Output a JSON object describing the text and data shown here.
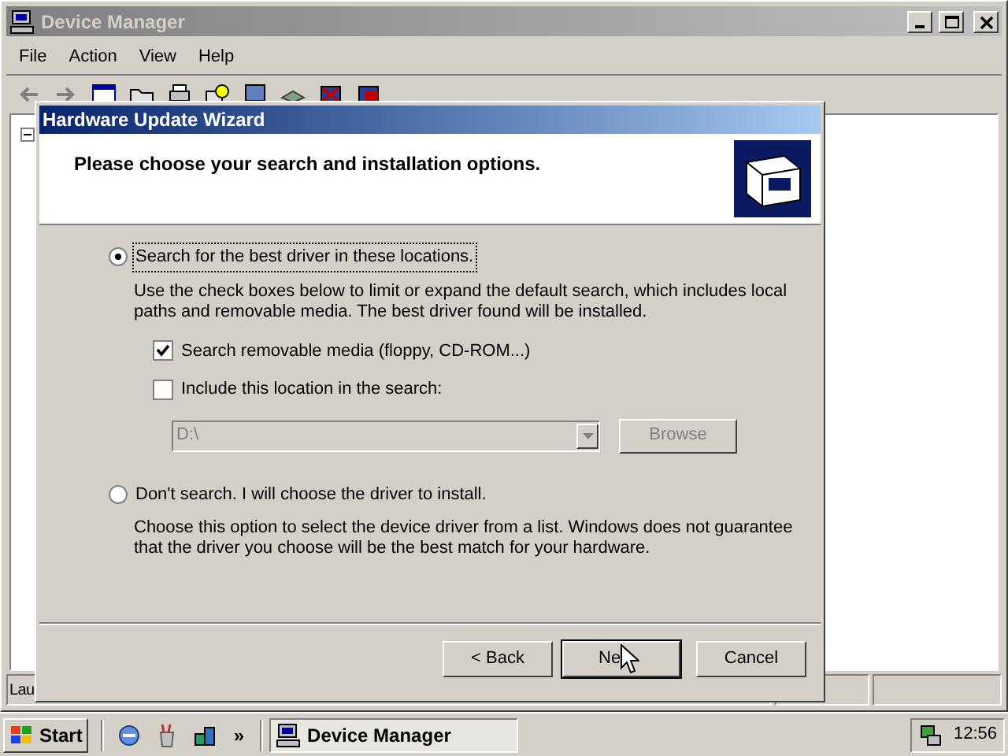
{
  "window": {
    "title": "Device Manager",
    "menu": [
      "File",
      "Action",
      "View",
      "Help"
    ],
    "status_bar": "Lau"
  },
  "wizard": {
    "title": "Hardware Update Wizard",
    "heading": "Please choose your search and installation options.",
    "options": [
      {
        "label": "Search for the best driver in these locations.",
        "selected": true,
        "description": "Use the check boxes below to limit or expand the default search, which includes local paths and removable media. The best driver found will be installed."
      },
      {
        "label": "Don't search. I will choose the driver to install.",
        "selected": false,
        "description": "Choose this option to select the device driver from a list.  Windows does not guarantee that the driver you choose will be the best match for your hardware."
      }
    ],
    "checkboxes": [
      {
        "label": "Search removable media (floppy, CD-ROM...)",
        "checked": true
      },
      {
        "label": "Include this location in the search:",
        "checked": false
      }
    ],
    "location": {
      "value": "D:\\",
      "disabled": true
    },
    "browse_button": {
      "label": "Browse",
      "disabled": true
    },
    "buttons": [
      {
        "label": "< Back",
        "default": false
      },
      {
        "label": "Ne",
        "default": true
      },
      {
        "label": "Cancel",
        "default": false
      }
    ]
  },
  "taskbar": {
    "start": "Start",
    "more": "»",
    "task": "Device Manager",
    "clock": "12:56"
  }
}
